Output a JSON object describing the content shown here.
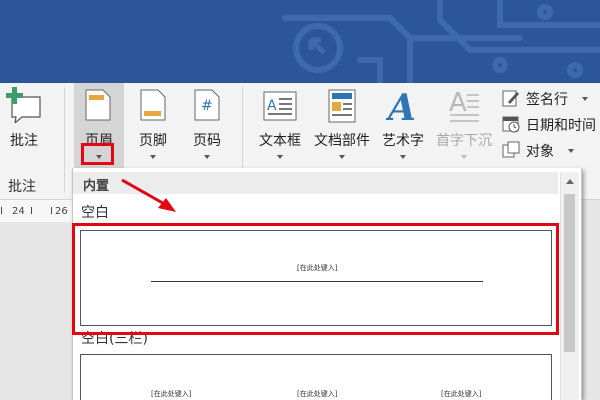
{
  "ribbon": {
    "comment": {
      "label": "批注",
      "icon": "comment-plus-icon"
    },
    "comment_group_label": "批注",
    "header": {
      "label": "页眉",
      "icon": "header-page-icon"
    },
    "footer": {
      "label": "页脚",
      "icon": "footer-page-icon"
    },
    "page_number": {
      "label": "页码",
      "icon": "page-number-icon",
      "glyph": "#"
    },
    "textbox": {
      "label": "文本框",
      "icon": "textbox-icon"
    },
    "quick_parts": {
      "label": "文档部件",
      "icon": "quick-parts-icon"
    },
    "wordart": {
      "label": "艺术字",
      "icon": "wordart-icon",
      "glyph": "A"
    },
    "drop_cap": {
      "label": "首字下沉",
      "icon": "drop-cap-icon",
      "glyph": "A",
      "disabled": true
    },
    "signature_line": {
      "label": "签名行",
      "icon": "signature-line-icon"
    },
    "date_time": {
      "label": "日期和时间",
      "icon": "calendar-icon"
    },
    "object": {
      "label": "对象",
      "icon": "object-icon"
    }
  },
  "ruler": {
    "ticks": [
      "24",
      "26"
    ]
  },
  "gallery": {
    "section_header": "内置",
    "items": [
      {
        "title": "空白",
        "placeholders": [
          "[在此处键入]"
        ]
      },
      {
        "title": "空白(三栏)",
        "placeholders": [
          "[在此处键入]",
          "[在此处键入]",
          "[在此处键入]"
        ]
      }
    ]
  },
  "colors": {
    "title_bar": "#2b579a",
    "highlight": "#e30613",
    "wordart_blue": "#2e75b6"
  }
}
